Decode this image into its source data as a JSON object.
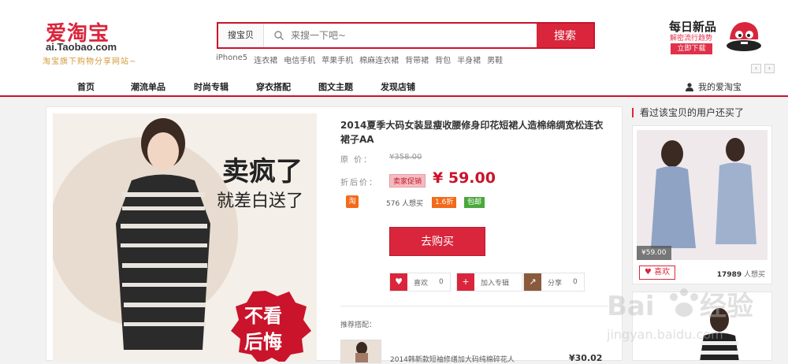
{
  "header": {
    "logo_text": "爱淘宝",
    "logo_domain": "ai.Taobao.com",
    "logo_slogan": "淘宝旗下购物分享网站~",
    "search": {
      "category": "搜宝贝",
      "placeholder": "来搜一下吧~",
      "button": "搜索"
    },
    "hotwords": [
      "iPhone5",
      "连衣裙",
      "电信手机",
      "苹果手机",
      "棉麻连衣裙",
      "背带裙",
      "背包",
      "半身裙",
      "男鞋"
    ],
    "promo": {
      "title": "每日新品",
      "subtitle": "解密流行趋势",
      "button": "立即下载"
    },
    "arrows": [
      "‹",
      "›"
    ]
  },
  "nav": {
    "items": [
      "首页",
      "潮流单品",
      "时尚专辑",
      "穿衣搭配",
      "图文主题",
      "发现店铺"
    ],
    "my_taobao": "我的爱淘宝"
  },
  "product": {
    "image_text_top": "卖疯了",
    "image_text_mid": "就差白送了",
    "image_stamp": [
      "不看",
      "后悔"
    ],
    "title": "2014夏季大码女装显瘦收腰修身印花短裙人造棉绵绸宽松连衣裙子AA",
    "original_label": "原 价：",
    "original_price": "¥358.00",
    "discount_label": "折后价：",
    "promo_tag": "卖家促销",
    "price_symbol": "¥",
    "price": "59.00",
    "taobao_icon": "淘",
    "sold": "576 人想买",
    "discount_badge": "1.6折",
    "shipping_badge": "包邮",
    "buy_button": "去购买",
    "actions": [
      {
        "label": "喜欢",
        "count": "0",
        "icon": "heart-icon",
        "color": "#d9263c"
      },
      {
        "label": "加入专辑",
        "count": "",
        "icon": "plus-icon",
        "color": "#d9263c"
      },
      {
        "label": "分享",
        "count": "0",
        "icon": "share-icon",
        "color": "#8a5a3c"
      }
    ],
    "recommend_label": "推荐搭配：",
    "recommend_item": {
      "title": "2014韩新款短袖修缮加大码纯棉碎花人",
      "price": "¥30.02"
    }
  },
  "sidebar": {
    "title": "看过该宝贝的用户还买了",
    "card": {
      "price": "¥59.00",
      "like": "喜欢",
      "want_count": "17989",
      "want_suffix": "人想买"
    }
  },
  "colors": {
    "brand_red": "#d9263c",
    "price_red": "#c9142b",
    "orange": "#f26b1a",
    "green": "#4aa83a"
  }
}
